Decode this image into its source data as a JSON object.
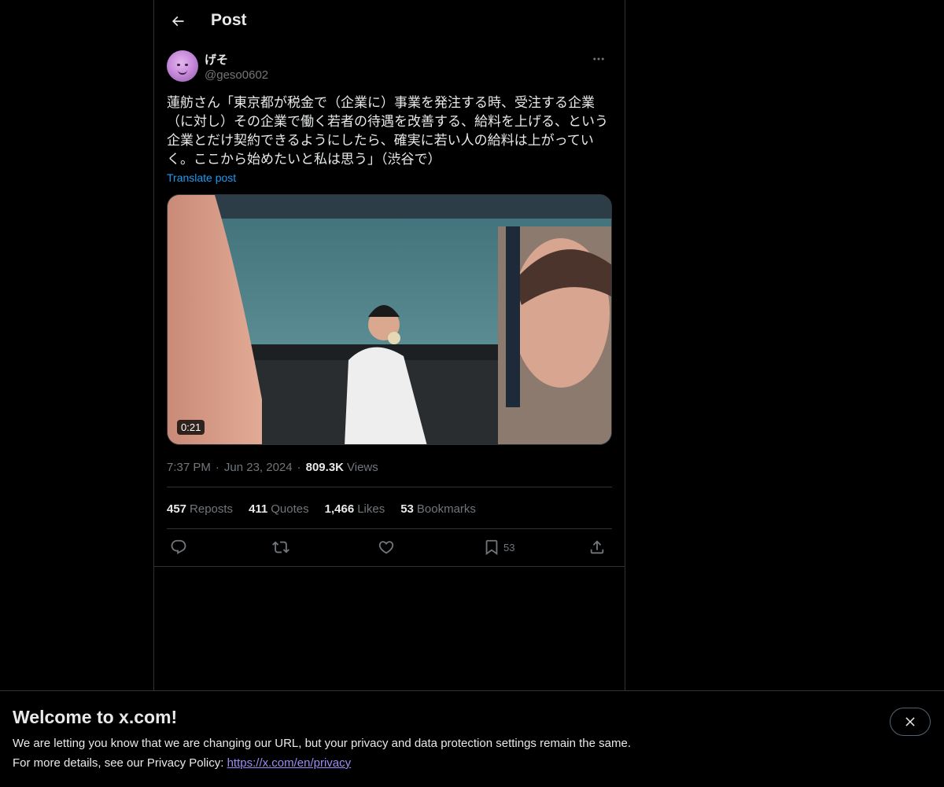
{
  "header": {
    "title": "Post",
    "back_icon": "arrow-left-icon"
  },
  "author": {
    "name": "げそ",
    "handle": "@geso0602",
    "avatar_color": "#c98bdc"
  },
  "post": {
    "text": "蓮舫さん「東京都が税金で（企業に）事業を発注する時、受注する企業（に対し）その企業で働く若者の待遇を改善する、給料を上げる、という企業とだけ契約できるようにしたら、確実に若い人の給料は上がっていく。ここから始めたいと私は思う」（渋谷で）",
    "translate_label": "Translate post",
    "video_duration": "0:21",
    "time": "7:37 PM",
    "date": "Jun 23, 2024",
    "separator": "·",
    "views_count": "809.3K",
    "views_label": "Views"
  },
  "stats": {
    "reposts_count": "457",
    "reposts_label": "Reposts",
    "quotes_count": "411",
    "quotes_label": "Quotes",
    "likes_count": "1,466",
    "likes_label": "Likes",
    "bookmarks_count": "53",
    "bookmarks_label": "Bookmarks"
  },
  "actions": {
    "reply_icon": "reply-icon",
    "repost_icon": "repost-icon",
    "like_icon": "heart-icon",
    "bookmark_icon": "bookmark-icon",
    "bookmark_count": "53",
    "share_icon": "share-icon"
  },
  "banner": {
    "title": "Welcome to x.com!",
    "line1": "We are letting you know that we are changing our URL, but your privacy and data protection settings remain the same.",
    "line2_prefix": "For more details, see our Privacy Policy: ",
    "link_text": "https://x.com/en/privacy",
    "close_icon": "close-icon"
  },
  "colors": {
    "background": "#000000",
    "text_primary": "#e7e9ea",
    "text_secondary": "#71767b",
    "accent": "#1d9bf0",
    "border": "#2f3336",
    "link": "#9d8cf5"
  }
}
